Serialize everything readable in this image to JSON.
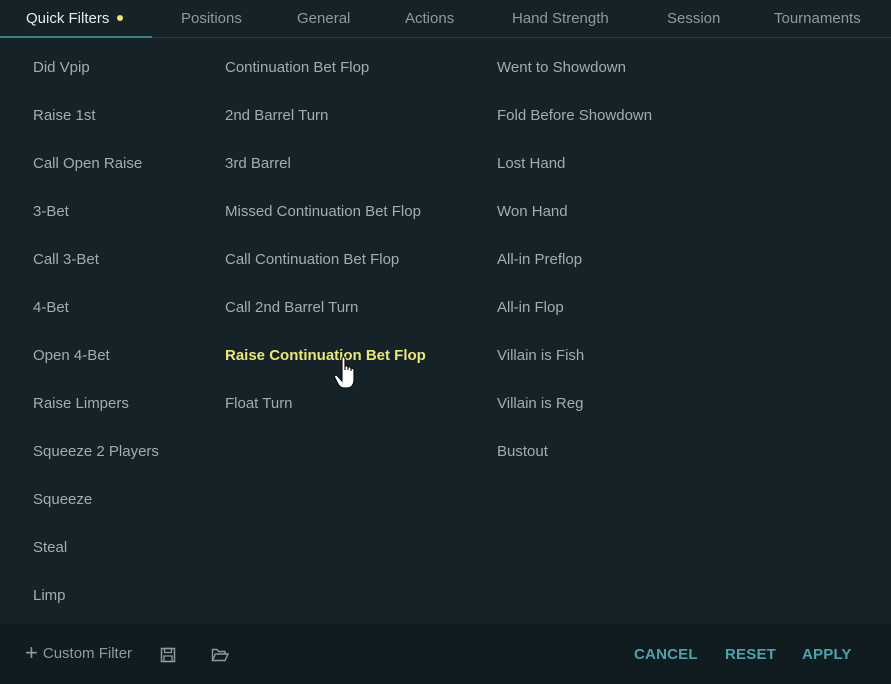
{
  "tabs": [
    {
      "label": "Quick Filters",
      "active": true,
      "indicator": true
    },
    {
      "label": "Positions"
    },
    {
      "label": "General"
    },
    {
      "label": "Actions"
    },
    {
      "label": "Hand Strength"
    },
    {
      "label": "Session"
    },
    {
      "label": "Tournaments"
    }
  ],
  "columns": [
    [
      "Did Vpip",
      "Raise 1st",
      "Call Open Raise",
      "3-Bet",
      "Call 3-Bet",
      "4-Bet",
      "Open 4-Bet",
      "Raise Limpers",
      "Squeeze 2 Players",
      "Squeeze",
      "Steal",
      "Limp"
    ],
    [
      "Continuation Bet Flop",
      "2nd Barrel Turn",
      "3rd Barrel",
      "Missed Continuation Bet Flop",
      "Call Continuation Bet Flop",
      "Call 2nd Barrel Turn",
      "Raise Continuation Bet Flop",
      "Float Turn"
    ],
    [
      "Went to Showdown",
      "Fold Before Showdown",
      "Lost Hand",
      "Won Hand",
      "All-in Preflop",
      "All-in Flop",
      "Villain is Fish",
      "Villain is Reg",
      "Bustout"
    ]
  ],
  "hovered_item": "Raise Continuation Bet Flop",
  "footer": {
    "custom_filter_label": "Custom Filter",
    "save_icon": "save-icon",
    "open_icon": "folder-open-icon",
    "cancel_label": "CANCEL",
    "reset_label": "RESET",
    "apply_label": "APPLY"
  },
  "colors": {
    "background": "#152227",
    "footer": "#111c20",
    "accent": "#4fa2aa",
    "highlight": "#e9e77a"
  }
}
